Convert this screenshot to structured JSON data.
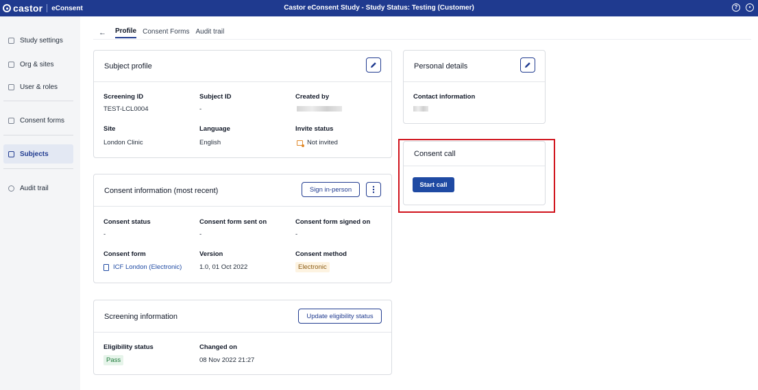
{
  "topbar": {
    "brand": "castor",
    "product": "eConsent",
    "title": "Castor eConsent Study  - Study Status: Testing (Customer)",
    "icons": [
      "help-icon",
      "account-icon"
    ]
  },
  "sidebar": {
    "items": [
      {
        "label": "Study settings",
        "icon": "book-icon"
      },
      {
        "label": "Org & sites",
        "icon": "building-icon"
      },
      {
        "label": "User & roles",
        "icon": "users-icon"
      },
      {
        "label": "Consent forms",
        "icon": "document-icon"
      },
      {
        "label": "Subjects",
        "icon": "subjects-icon",
        "active": true
      },
      {
        "label": "Audit trail",
        "icon": "history-icon"
      }
    ]
  },
  "tabs": {
    "items": [
      "Profile",
      "Consent Forms",
      "Audit trail"
    ],
    "active": "Profile"
  },
  "subject_profile": {
    "title": "Subject profile",
    "fields": [
      {
        "label": "Screening ID",
        "value": "TEST-LCL0004"
      },
      {
        "label": "Subject ID",
        "value": "-"
      },
      {
        "label": "Created by",
        "value": ""
      },
      {
        "label": "Site",
        "value": "London Clinic"
      },
      {
        "label": "Language",
        "value": "English"
      },
      {
        "label": "Invite status",
        "value": "Not invited"
      }
    ]
  },
  "personal_details": {
    "title": "Personal details",
    "fields": [
      {
        "label": "Contact information",
        "value": ""
      }
    ]
  },
  "consent_call": {
    "title": "Consent call",
    "button": "Start call"
  },
  "consent_info": {
    "title": "Consent information (most recent)",
    "button": "Sign in-person",
    "fields": [
      {
        "label": "Consent status",
        "value": "-"
      },
      {
        "label": "Consent form sent on",
        "value": "-"
      },
      {
        "label": "Consent form signed on",
        "value": "-"
      },
      {
        "label": "Consent form",
        "value": "ICF London (Electronic)"
      },
      {
        "label": "Version",
        "value": "1.0, 01 Oct 2022"
      },
      {
        "label": "Consent method",
        "value": "Electronic"
      }
    ]
  },
  "screening_info": {
    "title": "Screening information",
    "button": "Update eligibility status",
    "fields": [
      {
        "label": "Eligibility status",
        "value": "Pass"
      },
      {
        "label": "Changed on",
        "value": "08 Nov 2022 21:27"
      }
    ]
  },
  "colors": {
    "topbar": "#1f3a8f",
    "accent": "#1f4aa3",
    "highlight": "#d0121b"
  }
}
